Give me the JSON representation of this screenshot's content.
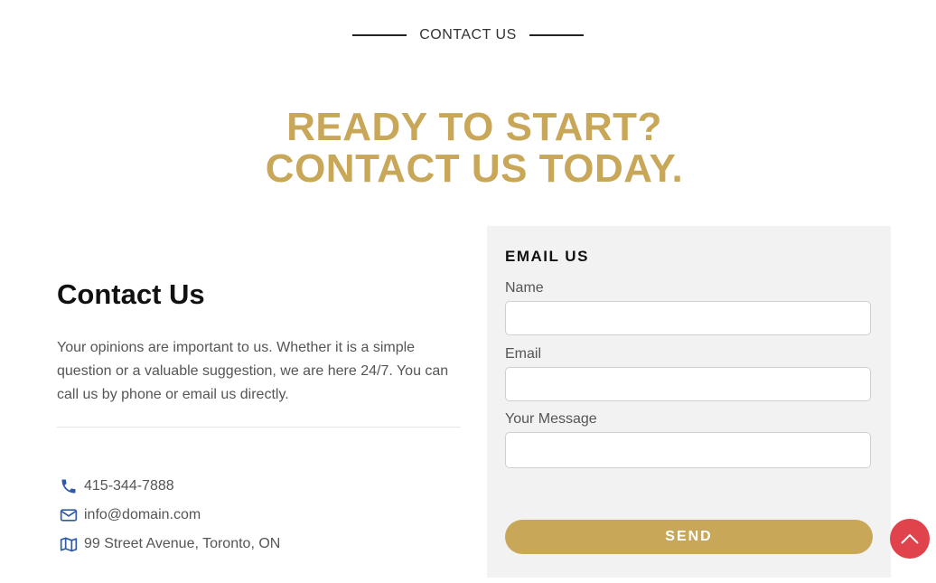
{
  "eyebrow": {
    "text": "CONTACT US"
  },
  "headline": {
    "line1": "READY TO START?",
    "line2": "CONTACT US TODAY."
  },
  "contact_info": {
    "title": "Contact Us",
    "description": "Your opinions are important to us. Whether it is a simple question or a valuable suggestion, we are here 24/7. You can call us by phone or email us directly.",
    "phone": "415-344-7888",
    "email": "info@domain.com",
    "address": "99 Street Avenue, Toronto, ON"
  },
  "form": {
    "title": "EMAIL US",
    "name_label": "Name",
    "email_label": "Email",
    "message_label": "Your Message",
    "send_label": "SEND"
  },
  "colors": {
    "accent": "#c9a758",
    "scroll_button": "#e0434c",
    "icon": "#2f5aa8"
  },
  "icons": [
    "phone-icon",
    "envelope-icon",
    "map-icon",
    "arrow-up-icon"
  ]
}
